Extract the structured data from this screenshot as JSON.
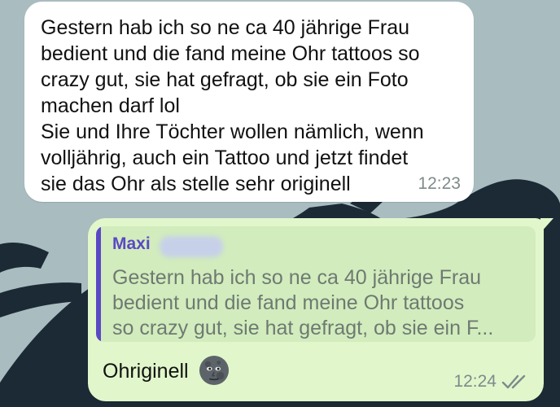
{
  "incoming": {
    "text": "Gestern hab ich so ne ca 40 jährige Frau\nbedient und die fand meine Ohr tattoos so\ncrazy gut, sie hat gefragt, ob sie ein Foto\nmachen darf lol\nSie und Ihre Töchter wollen nämlich, wenn\nvolljährig, auch ein Tattoo und jetzt findet\nsie das Ohr als stelle sehr originell",
    "time": "12:23"
  },
  "outgoing": {
    "quote": {
      "sender": "Maxi",
      "text": "Gestern hab ich so ne ca 40 jährige Frau\nbedient und die fand meine Ohr tattoos\nso crazy gut, sie hat gefragt, ob sie ein F..."
    },
    "text": "Ohriginell",
    "emoji": "new-moon-face-icon",
    "time": "12:24",
    "status_icon": "double-check-icon"
  },
  "colors": {
    "incoming_bubble": "#ffffff",
    "outgoing_bubble": "#e1f7cb",
    "quote_background": "#d2ecbd",
    "quote_accent": "#5b48c6",
    "timestamp": "#7f8a8c",
    "wallpaper": "#a9bcbf"
  }
}
